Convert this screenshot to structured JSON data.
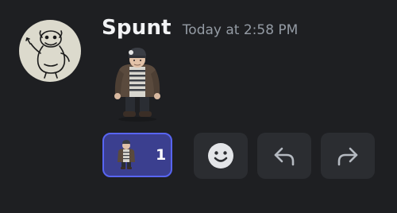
{
  "message": {
    "username": "Spunt",
    "timestamp": "Today at 2:58 PM",
    "sticker": "character-sticker"
  },
  "reactions": [
    {
      "icon": "character-sticker-icon",
      "count": "1"
    }
  ],
  "actions": {
    "add_reaction_icon": "smiley-face-icon",
    "reply_icon": "reply-arrow-icon",
    "forward_icon": "forward-arrow-icon"
  },
  "colors": {
    "background": "#1e1f22",
    "username": "#f2f3f5",
    "timestamp": "#949ba4",
    "reaction_active_bg": "#3b3f8f",
    "reaction_active_border": "#5865f2",
    "button_bg": "#2b2d31"
  }
}
